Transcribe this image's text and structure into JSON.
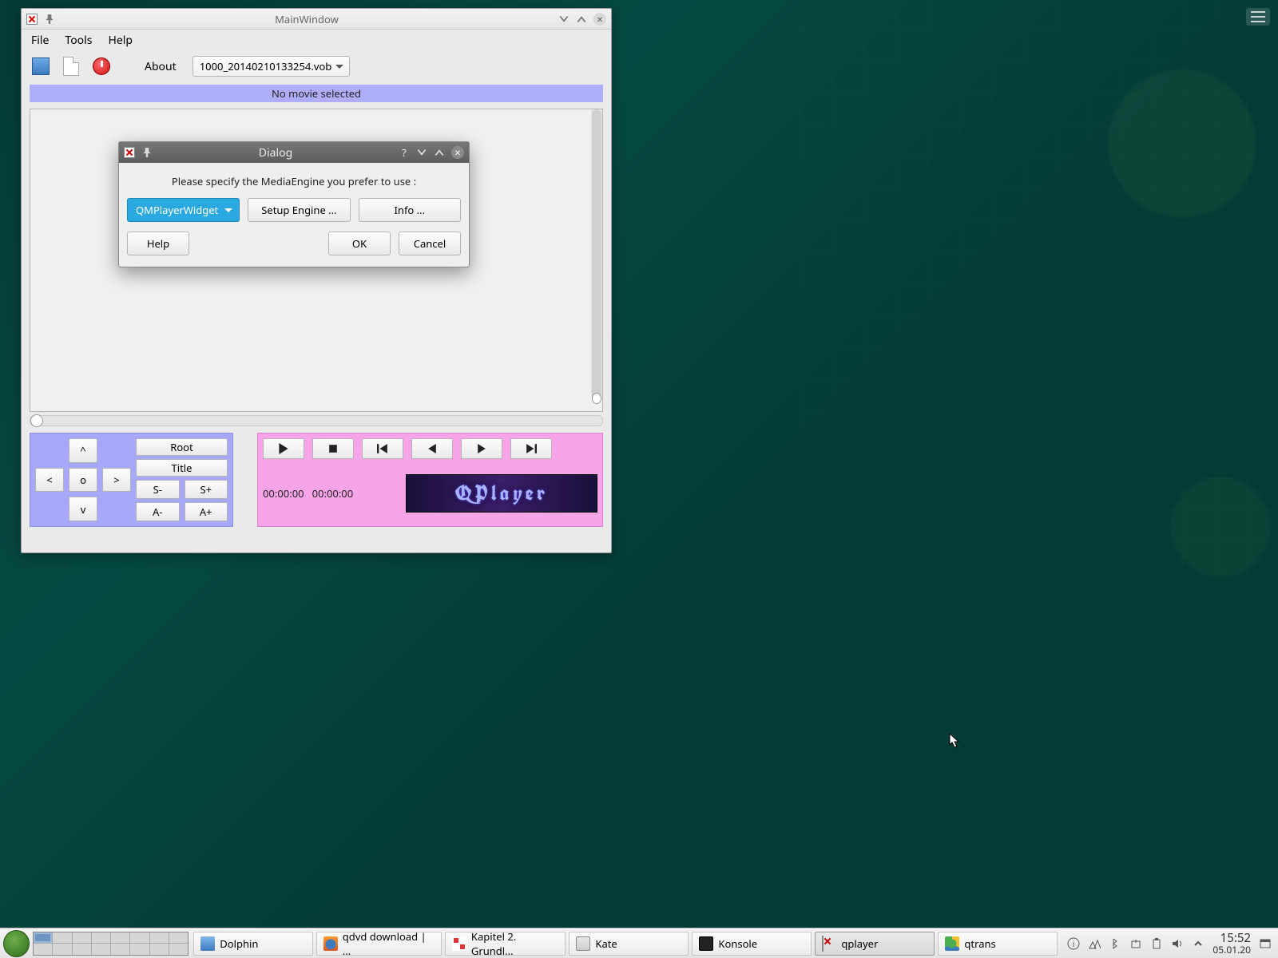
{
  "mainwin": {
    "title": "MainWindow",
    "menubar": [
      "File",
      "Tools",
      "Help"
    ],
    "about_label": "About",
    "file_combo": "1000_20140210133254.vob",
    "status": "No movie selected",
    "nav": {
      "up": "^",
      "down": "v",
      "left": "<",
      "right": ">",
      "center": "o",
      "root": "Root",
      "title": "Title",
      "s_minus": "S-",
      "s_plus": "S+",
      "a_minus": "A-",
      "a_plus": "A+"
    },
    "playback": {
      "time_current": "00:00:00",
      "time_total": "00:00:00",
      "logo_text": "QPlayer"
    }
  },
  "dialog": {
    "title": "Dialog",
    "message": "Please specify the MediaEngine you prefer to use :",
    "engine_selected": "QMPlayerWidget",
    "setup_btn": "Setup Engine ...",
    "info_btn": "Info ...",
    "help_btn": "Help",
    "ok_btn": "OK",
    "cancel_btn": "Cancel"
  },
  "taskbar": {
    "items": [
      {
        "label": "Dolphin"
      },
      {
        "label": "qdvd download | ..."
      },
      {
        "label": "Kapitel 2. Grundl..."
      },
      {
        "label": "Kate"
      },
      {
        "label": "Konsole"
      },
      {
        "label": "qplayer"
      },
      {
        "label": "qtrans"
      }
    ],
    "clock_time": "15:52",
    "clock_date": "05.01.20"
  }
}
